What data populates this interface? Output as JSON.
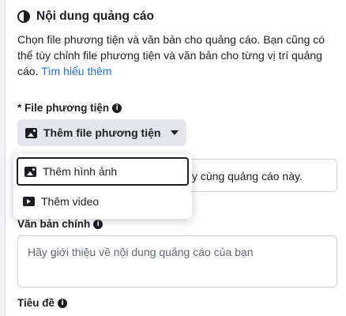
{
  "section": {
    "title": "Nội dung quảng cáo",
    "description": "Chọn file phương tiện và văn bản cho quảng cáo. Bạn cũng có thể tùy chỉnh file phương tiện và văn bản cho từng vị trí quảng cáo.",
    "learn_more": "Tìm hiểu thêm"
  },
  "media_field": {
    "label": "* File phương tiện",
    "button_label": "Thêm file phương tiện",
    "hidden_text": "y cùng quảng cáo này."
  },
  "dropdown": {
    "items": [
      {
        "label": "Thêm hình ảnh",
        "icon": "image-icon",
        "selected": true
      },
      {
        "label": "Thêm video",
        "icon": "video-icon",
        "selected": false
      }
    ]
  },
  "primary_text": {
    "label": "Văn bản chính",
    "placeholder": "Hãy giới thiệu về nội dung quảng cáo của bạn"
  },
  "headline": {
    "label": "Tiêu đề"
  },
  "colors": {
    "link": "#216fdb",
    "button_bg": "#e4e6eb",
    "text": "#1c1e21"
  }
}
